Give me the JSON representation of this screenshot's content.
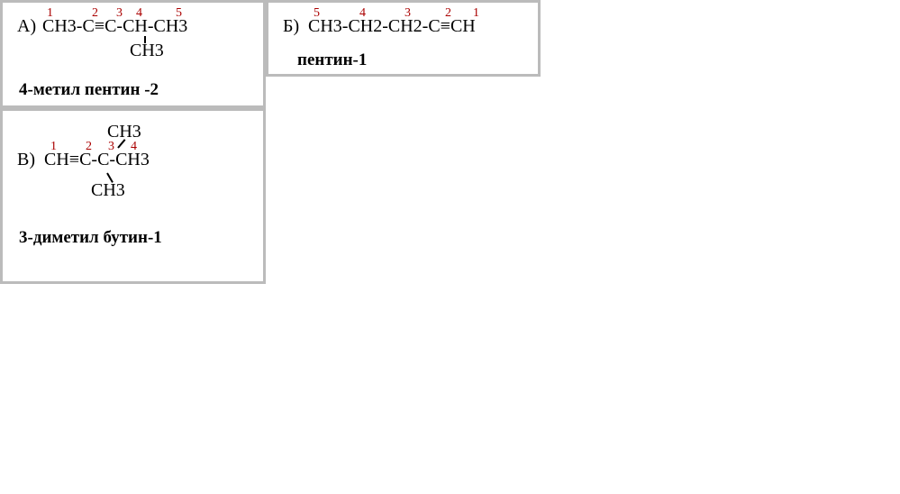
{
  "a": {
    "label": "А)",
    "formula": "CH3-C≡C-CH-CH3",
    "branch": "CH3",
    "nums": [
      "1",
      "2",
      "3",
      "4",
      "5"
    ],
    "name": "4-метил пентин -2"
  },
  "b": {
    "label": "Б)",
    "formula": "CH3-CH2-CH2-C≡CH",
    "nums": [
      "5",
      "4",
      "3",
      "2",
      "1"
    ],
    "name": "пентин-1"
  },
  "c": {
    "label": "В)",
    "formula": "CH≡C-C-CH3",
    "branch_top": "CH3",
    "branch_bottom": "CH3",
    "nums": [
      "1",
      "2",
      "3",
      "4"
    ],
    "name": "3-диметил бутин-1"
  }
}
